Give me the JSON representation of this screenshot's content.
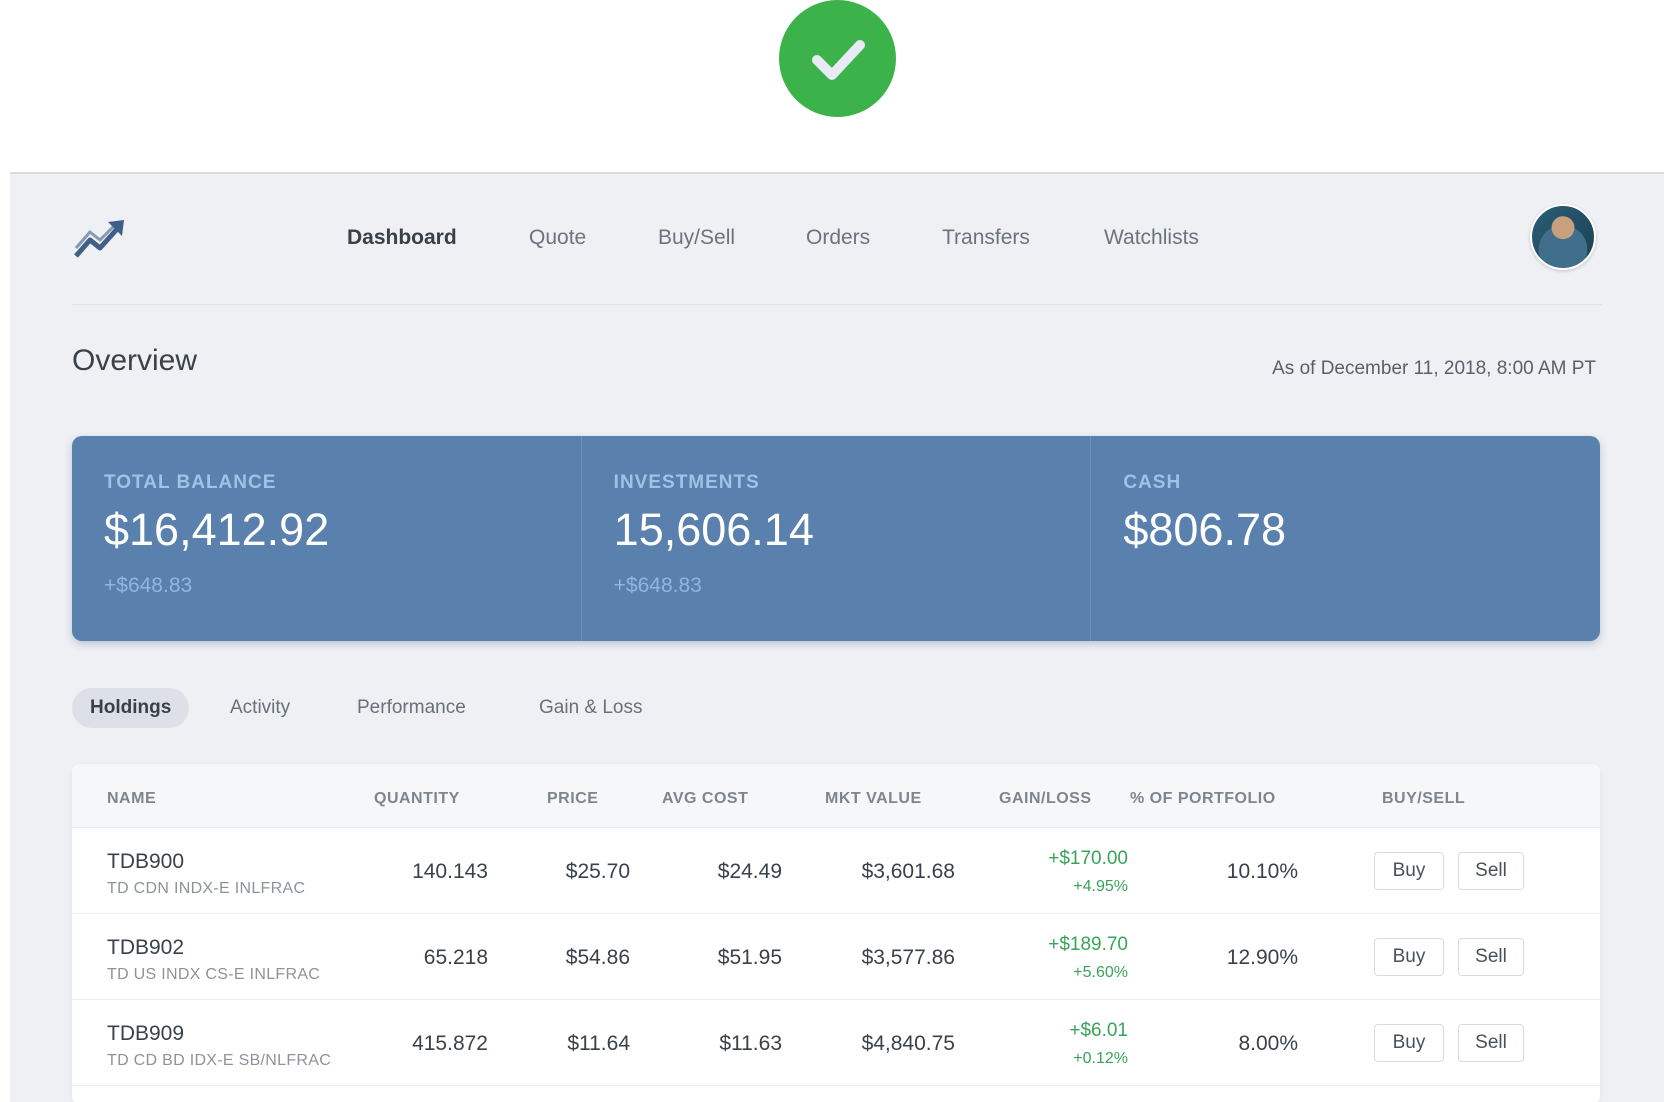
{
  "header": {
    "logo_icon": "trending-up-icon",
    "nav": [
      {
        "label": "Dashboard",
        "active": true
      },
      {
        "label": "Quote",
        "active": false
      },
      {
        "label": "Buy/Sell",
        "active": false
      },
      {
        "label": "Orders",
        "active": false
      },
      {
        "label": "Transfers",
        "active": false
      },
      {
        "label": "Watchlists",
        "active": false
      }
    ],
    "avatar_icon": "user-avatar"
  },
  "overview": {
    "title": "Overview",
    "as_of": "As of December 11, 2018, 8:00 AM PT"
  },
  "balances": [
    {
      "label": "TOTAL BALANCE",
      "value": "$16,412.92",
      "change": "+$648.83"
    },
    {
      "label": "INVESTMENTS",
      "value": "15,606.14",
      "change": "+$648.83"
    },
    {
      "label": "CASH",
      "value": "$806.78",
      "change": ""
    }
  ],
  "tabs": [
    {
      "label": "Holdings",
      "active": true
    },
    {
      "label": "Activity",
      "active": false
    },
    {
      "label": "Performance",
      "active": false
    },
    {
      "label": "Gain & Loss",
      "active": false
    }
  ],
  "holdings": {
    "columns": [
      "NAME",
      "QUANTITY",
      "PRICE",
      "AVG COST",
      "MKT VALUE",
      "GAIN/LOSS",
      "% OF PORTFOLIO",
      "BUY/SELL"
    ],
    "rows": [
      {
        "symbol": "TDB900",
        "name": "TD CDN INDX-E INLFRAC",
        "quantity": "140.143",
        "price": "$25.70",
        "avg_cost": "$24.49",
        "mkt_value": "$3,601.68",
        "gain": "+$170.00",
        "gain_pct": "+4.95%",
        "portfolio": "10.10%",
        "buy": "Buy",
        "sell": "Sell"
      },
      {
        "symbol": "TDB902",
        "name": "TD US INDX CS-E INLFRAC",
        "quantity": "65.218",
        "price": "$54.86",
        "avg_cost": "$51.95",
        "mkt_value": "$3,577.86",
        "gain": "+$189.70",
        "gain_pct": "+5.60%",
        "portfolio": "12.90%",
        "buy": "Buy",
        "sell": "Sell"
      },
      {
        "symbol": "TDB909",
        "name": "TD CD BD IDX-E SB/NLFRAC",
        "quantity": "415.872",
        "price": "$11.64",
        "avg_cost": "$11.63",
        "mkt_value": "$4,840.75",
        "gain": "+$6.01",
        "gain_pct": "+0.12%",
        "portfolio": "8.00%",
        "buy": "Buy",
        "sell": "Sell"
      }
    ]
  },
  "colors": {
    "accent_card": "#5a80ad",
    "gain_green": "#3aa35a",
    "success_badge": "#3cb34a"
  },
  "badge_icon": "checkmark-icon"
}
